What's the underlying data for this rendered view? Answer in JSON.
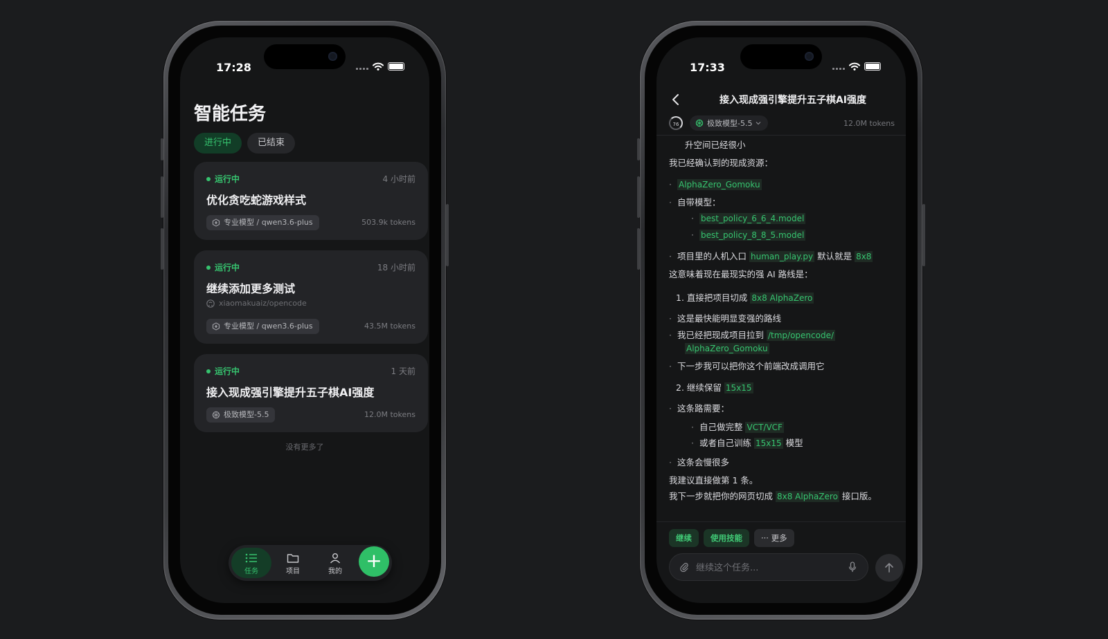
{
  "left": {
    "status_time": "17:28",
    "title": "智能任务",
    "tabs": [
      {
        "label": "进行中"
      },
      {
        "label": "已结束"
      }
    ],
    "tasks": [
      {
        "status": "运行中",
        "time": "4 小时前",
        "title": "优化贪吃蛇游戏样式",
        "repo": "",
        "model": "专业模型 / qwen3.6-plus",
        "tokens": "503.9k tokens"
      },
      {
        "status": "运行中",
        "time": "18 小时前",
        "title": "继续添加更多测试",
        "repo": "xiaomakuaiz/opencode",
        "model": "专业模型 / qwen3.6-plus",
        "tokens": "43.5M tokens"
      },
      {
        "status": "运行中",
        "time": "1 天前",
        "title": "接入现成强引擎提升五子棋AI强度",
        "repo": "",
        "model": "极致模型-5.5",
        "tokens": "12.0M tokens"
      }
    ],
    "no_more": "没有更多了",
    "nav": {
      "tasks": "任务",
      "projects": "项目",
      "mine": "我的",
      "add": "+"
    }
  },
  "right": {
    "status_time": "17:33",
    "title": "接入现成强引擎提升五子棋AI强度",
    "progress": "76",
    "model": "极致模型-5.5",
    "tokens": "12.0M tokens",
    "lines": {
      "l0": "升空间已经很小",
      "l1": "我已经确认到的现成资源：",
      "l2_code": "AlphaZero_Gomoku",
      "l3": "自带模型：",
      "l4_code": "best_policy_6_6_4.model",
      "l5_code": "best_policy_8_8_5.model",
      "l6_a": "项目里的人机入口",
      "l6_code1": "human_play.py",
      "l6_b": "默认就是",
      "l6_code2": "8x8",
      "l7": "这意味着现在最现实的强 AI 路线是：",
      "l8_num": "1.",
      "l8_a": "直接把项目切成",
      "l8_code": "8x8 AlphaZero",
      "l9": "这是最快能明显变强的路线",
      "l10_a": "我已经把现成项目拉到",
      "l10_code": "/tmp/opencode/",
      "l10_code2": "AlphaZero_Gomoku",
      "l11": "下一步我可以把你这个前端改成调用它",
      "l12_num": "2.",
      "l12_a": "继续保留",
      "l12_code": "15x15",
      "l13": "这条路需要：",
      "l14_a": "自己做完整",
      "l14_code": "VCT/VCF",
      "l15_a": "或者自己训练",
      "l15_code": "15x15",
      "l15_b": "模型",
      "l16": "这条会慢很多",
      "l17": "我建议直接做第 1 条。",
      "l18_a": "我下一步就把你的网页切成",
      "l18_code": "8x8 AlphaZero",
      "l18_b": "接口版。"
    },
    "quick_replies": {
      "continue": "继续",
      "skills": "使用技能",
      "more": "更多"
    },
    "composer_placeholder": "继续这个任务..."
  }
}
